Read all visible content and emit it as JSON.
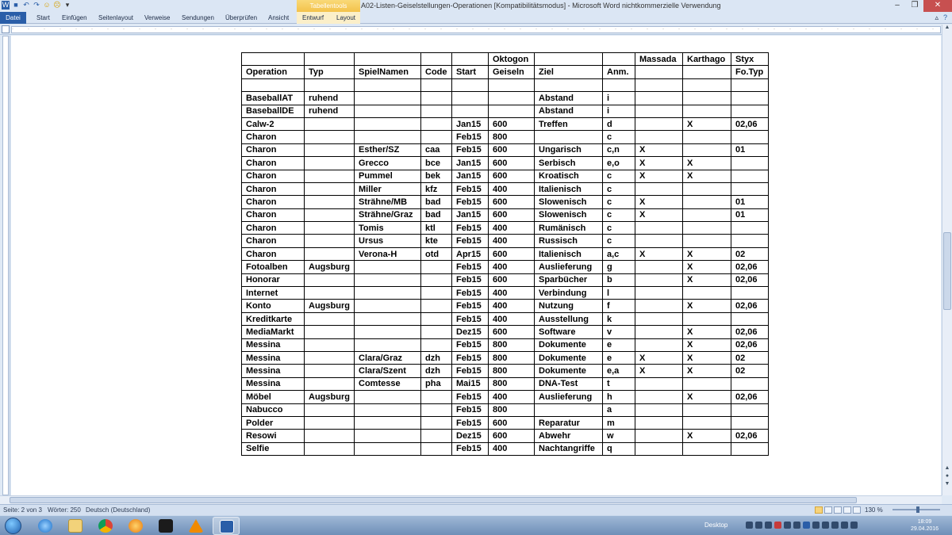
{
  "window": {
    "title": "A02-Listen-Geiselstellungen-Operationen [Kompatibilitätsmodus] - Microsoft Word nichtkommerzielle Verwendung",
    "context_group": "Tabellentools"
  },
  "ribbon": {
    "tabs": [
      "Datei",
      "Start",
      "Einfügen",
      "Seitenlayout",
      "Verweise",
      "Sendungen",
      "Überprüfen",
      "Ansicht",
      "Entwurf",
      "Layout"
    ]
  },
  "status": {
    "page": "Seite: 2 von 3",
    "words": "Wörter: 250",
    "language": "Deutsch (Deutschland)",
    "zoom": "130 %"
  },
  "taskbar": {
    "desktop_label": "Desktop",
    "time": "18:09",
    "date": "29.04.2016",
    "apps": [
      "internet-explorer",
      "file-explorer",
      "chrome",
      "media-player",
      "kindle",
      "vlc",
      "word"
    ]
  },
  "table": {
    "header1": [
      "",
      "",
      "",
      "",
      "",
      "Oktogon",
      "",
      "",
      "Massada",
      "Karthago",
      "Styx"
    ],
    "header2": [
      "Operation",
      "Typ",
      "SpielNamen",
      "Code",
      "Start",
      "Geiseln",
      "Ziel",
      "Anm.",
      "",
      "",
      "Fo.Typ"
    ],
    "rows": [
      [
        "",
        "",
        "",
        "",
        "",
        "",
        "",
        "",
        "",
        "",
        ""
      ],
      [
        "BaseballAT",
        "ruhend",
        "",
        "",
        "",
        "",
        "Abstand",
        "i",
        "",
        "",
        ""
      ],
      [
        "BaseballDE",
        "ruhend",
        "",
        "",
        "",
        "",
        "Abstand",
        "i",
        "",
        "",
        ""
      ],
      [
        "Calw-2",
        "",
        "",
        "",
        "Jan15",
        "600",
        "Treffen",
        "d",
        "",
        "X",
        "02,06"
      ],
      [
        "Charon",
        "",
        "",
        "",
        "Feb15",
        "800",
        "",
        "c",
        "",
        "",
        ""
      ],
      [
        "Charon",
        "",
        "Esther/SZ",
        "caa",
        "Feb15",
        "600",
        "Ungarisch",
        "c,n",
        "X",
        "",
        "01"
      ],
      [
        "Charon",
        "",
        "Grecco",
        "bce",
        "Jan15",
        "600",
        "Serbisch",
        "e,o",
        "X",
        "X",
        ""
      ],
      [
        "Charon",
        "",
        "Pummel",
        "bek",
        "Jan15",
        "600",
        "Kroatisch",
        "c",
        "X",
        "X",
        ""
      ],
      [
        "Charon",
        "",
        "Miller",
        "kfz",
        "Feb15",
        "400",
        "Italienisch",
        "c",
        "",
        "",
        ""
      ],
      [
        "Charon",
        "",
        "Strähne/MB",
        "bad",
        "Feb15",
        "600",
        "Slowenisch",
        "c",
        "X",
        "",
        "01"
      ],
      [
        "Charon",
        "",
        "Strähne/Graz",
        "bad",
        "Jan15",
        "600",
        "Slowenisch",
        "c",
        "X",
        "",
        "01"
      ],
      [
        "Charon",
        "",
        "Tomis",
        "ktl",
        "Feb15",
        "400",
        "Rumänisch",
        "c",
        "",
        "",
        ""
      ],
      [
        "Charon",
        "",
        "Ursus",
        "kte",
        "Feb15",
        "400",
        "Russisch",
        "c",
        "",
        "",
        ""
      ],
      [
        "Charon",
        "",
        "Verona-H",
        "otd",
        "Apr15",
        "600",
        "Italienisch",
        "a,c",
        "X",
        "X",
        "02"
      ],
      [
        "Fotoalben",
        "Augsburg",
        "",
        "",
        "Feb15",
        "400",
        "Auslieferung",
        "g",
        "",
        "X",
        "02,06"
      ],
      [
        "Honorar",
        "",
        "",
        "",
        "Feb15",
        "600",
        "Sparbücher",
        "b",
        "",
        "X",
        "02,06"
      ],
      [
        "Internet",
        "",
        "",
        "",
        "Feb15",
        "400",
        "Verbindung",
        "l",
        "",
        "",
        ""
      ],
      [
        "Konto",
        "Augsburg",
        "",
        "",
        "Feb15",
        "400",
        "Nutzung",
        "f",
        "",
        "X",
        "02,06"
      ],
      [
        "Kreditkarte",
        "",
        "",
        "",
        "Feb15",
        "400",
        "Ausstellung",
        "k",
        "",
        "",
        ""
      ],
      [
        "MediaMarkt",
        "",
        "",
        "",
        "Dez15",
        "600",
        "Software",
        "v",
        "",
        "X",
        "02,06"
      ],
      [
        "Messina",
        "",
        "",
        "",
        "Feb15",
        "800",
        "Dokumente",
        "e",
        "",
        "X",
        "02,06"
      ],
      [
        "Messina",
        "",
        "Clara/Graz",
        "dzh",
        "Feb15",
        "800",
        "Dokumente",
        "e",
        "X",
        "X",
        "02"
      ],
      [
        "Messina",
        "",
        "Clara/Szent",
        "dzh",
        "Feb15",
        "800",
        "Dokumente",
        "e,a",
        "X",
        "X",
        "02"
      ],
      [
        "Messina",
        "",
        "Comtesse",
        "pha",
        "Mai15",
        "800",
        "DNA-Test",
        "t",
        "",
        "",
        ""
      ],
      [
        "Möbel",
        "Augsburg",
        "",
        "",
        "Feb15",
        "400",
        "Auslieferung",
        "h",
        "",
        "X",
        "02,06"
      ],
      [
        "Nabucco",
        "",
        "",
        "",
        "Feb15",
        "800",
        "",
        "a",
        "",
        "",
        ""
      ],
      [
        "Polder",
        "",
        "",
        "",
        "Feb15",
        "600",
        "Reparatur",
        "m",
        "",
        "",
        ""
      ],
      [
        "Resowi",
        "",
        "",
        "",
        "Dez15",
        "600",
        "Abwehr",
        "w",
        "",
        "X",
        "02,06"
      ],
      [
        "Selfie",
        "",
        "",
        "",
        "Feb15",
        "400",
        "Nachtangriffe",
        "q",
        "",
        "",
        ""
      ]
    ]
  }
}
